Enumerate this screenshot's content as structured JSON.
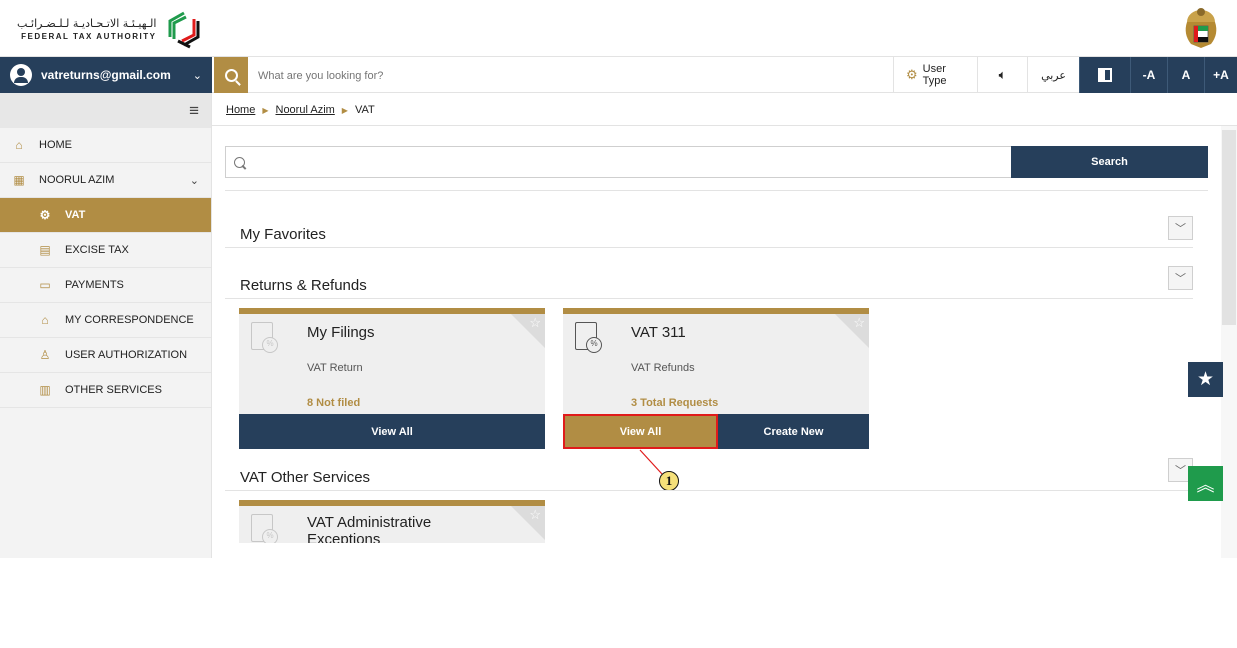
{
  "header": {
    "logo_ar": "الـهيـئـة الاتـحـاديـة لـلـضـرائـب",
    "logo_en": "FEDERAL TAX AUTHORITY"
  },
  "navbar": {
    "user_email": "vatreturns@gmail.com",
    "search_placeholder": "What are you looking for?",
    "user_type": "User Type",
    "arabic": "عربي",
    "font_decrease": "-A",
    "font_normal": "A",
    "font_increase": "+A"
  },
  "sidebar": {
    "items": [
      {
        "label": "HOME",
        "icon": "home-icon",
        "glyph": "⌂"
      },
      {
        "label": "NOORUL AZIM",
        "icon": "grid-icon",
        "glyph": "▦"
      },
      {
        "label": "VAT",
        "icon": "vat-icon",
        "glyph": "⚙"
      },
      {
        "label": "EXCISE TAX",
        "icon": "excise-icon",
        "glyph": "▤"
      },
      {
        "label": "PAYMENTS",
        "icon": "card-icon",
        "glyph": "▭"
      },
      {
        "label": "MY CORRESPONDENCE",
        "icon": "bank-icon",
        "glyph": "⌂"
      },
      {
        "label": "USER AUTHORIZATION",
        "icon": "user-icon",
        "glyph": "♙"
      },
      {
        "label": "OTHER SERVICES",
        "icon": "clipboard-icon",
        "glyph": "▥"
      }
    ]
  },
  "breadcrumb": {
    "home": "Home",
    "account": "Noorul Azim",
    "current": "VAT"
  },
  "search": {
    "button": "Search"
  },
  "sections": {
    "favorites": "My Favorites",
    "returns": "Returns & Refunds",
    "other": "VAT Other Services"
  },
  "cards": {
    "filings": {
      "title": "My Filings",
      "subtitle": "VAT Return",
      "count": "8 Not filed",
      "action": "View All"
    },
    "vat311": {
      "title": "VAT 311",
      "subtitle": "VAT Refunds",
      "count": "3 Total Requests",
      "action_view": "View All",
      "action_create": "Create New"
    },
    "admin": {
      "title": "VAT Administrative Exceptions"
    }
  },
  "callout": {
    "number": "1"
  },
  "colors": {
    "navy": "#263f5b",
    "gold": "#b18d44",
    "green": "#1f9b4c",
    "highlight": "#e01b1b"
  }
}
